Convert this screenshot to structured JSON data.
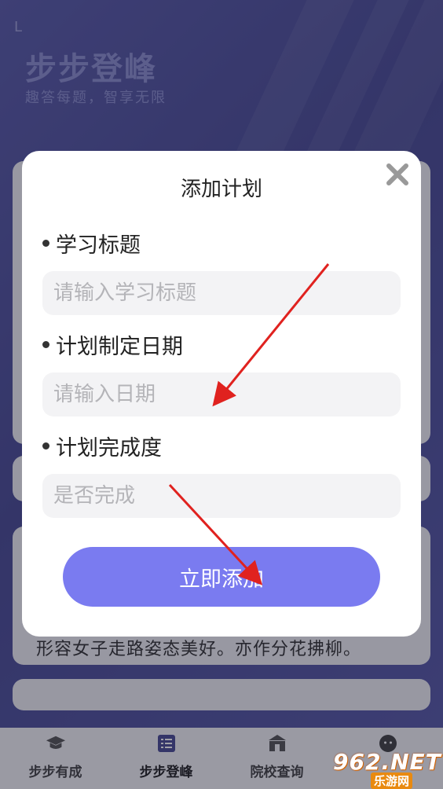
{
  "background": {
    "app_title": "步步登峰",
    "app_subtitle": "趣答每题，智享无限",
    "card_text": "形容女子走路姿态美好。亦作分花拂柳。"
  },
  "modal": {
    "title": "添加计划",
    "close_icon": "close-icon",
    "fields": [
      {
        "label": "学习标题",
        "placeholder": "请输入学习标题",
        "value": ""
      },
      {
        "label": "计划制定日期",
        "placeholder": "请输入日期",
        "value": ""
      },
      {
        "label": "计划完成度",
        "placeholder": "是否完成",
        "value": ""
      }
    ],
    "submit_label": "立即添加"
  },
  "tabbar": {
    "items": [
      {
        "label": "步步有成",
        "icon": "graduation-cap-icon"
      },
      {
        "label": "步步登峰",
        "icon": "list-icon"
      },
      {
        "label": "院校查询",
        "icon": "school-icon"
      },
      {
        "label": "",
        "icon": "profile-icon"
      }
    ],
    "active_index": 1
  },
  "watermark": {
    "logo": "962.NET",
    "sub": "乐游网"
  },
  "colors": {
    "accent": "#7a7bf0",
    "header_bg": "#4d4f96",
    "arrow": "#e0221f"
  }
}
